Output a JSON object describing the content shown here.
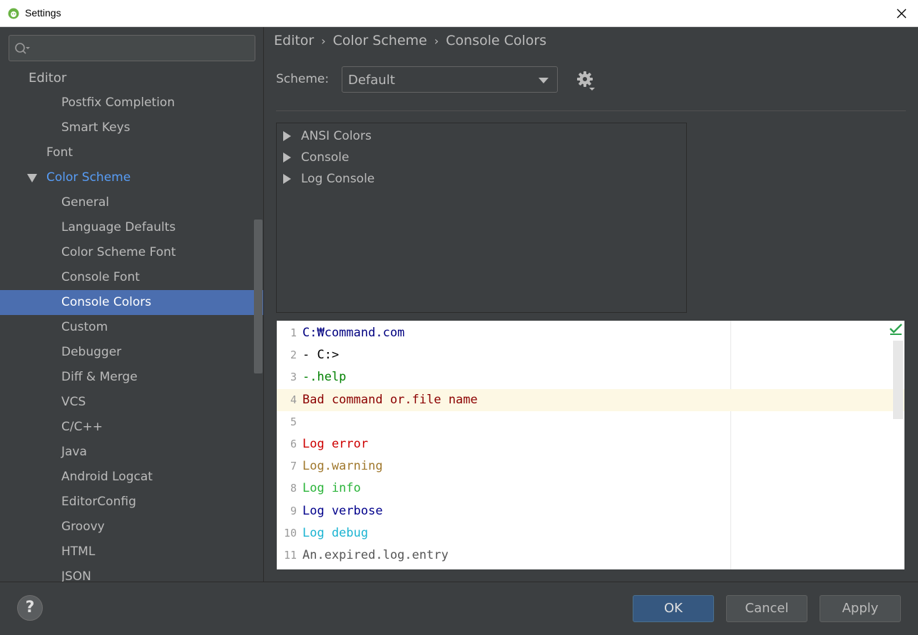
{
  "window": {
    "title": "Settings"
  },
  "search": {
    "placeholder": "",
    "value": ""
  },
  "sidebar": {
    "items": [
      {
        "label": "Editor",
        "level": 0
      },
      {
        "label": "Postfix Completion",
        "level": 2
      },
      {
        "label": "Smart Keys",
        "level": 2
      },
      {
        "label": "Font",
        "level": 1
      },
      {
        "label": "Color Scheme",
        "level": 1,
        "expanded": true
      },
      {
        "label": "General",
        "level": 2
      },
      {
        "label": "Language Defaults",
        "level": 2
      },
      {
        "label": "Color Scheme Font",
        "level": 2
      },
      {
        "label": "Console Font",
        "level": 2
      },
      {
        "label": "Console Colors",
        "level": 2,
        "selected": true
      },
      {
        "label": "Custom",
        "level": 2
      },
      {
        "label": "Debugger",
        "level": 2
      },
      {
        "label": "Diff & Merge",
        "level": 2
      },
      {
        "label": "VCS",
        "level": 2
      },
      {
        "label": "C/C++",
        "level": 2
      },
      {
        "label": "Java",
        "level": 2
      },
      {
        "label": "Android Logcat",
        "level": 2
      },
      {
        "label": "EditorConfig",
        "level": 2
      },
      {
        "label": "Groovy",
        "level": 2
      },
      {
        "label": "HTML",
        "level": 2
      },
      {
        "label": "JSON",
        "level": 2
      }
    ]
  },
  "breadcrumb": {
    "items": [
      "Editor",
      "Color Scheme",
      "Console Colors"
    ],
    "separator": "›"
  },
  "scheme": {
    "label": "Scheme:",
    "value": "Default"
  },
  "attributes": {
    "items": [
      "ANSI Colors",
      "Console",
      "Log Console"
    ]
  },
  "preview": {
    "lines": [
      {
        "num": "1",
        "text": "C:\\command.com",
        "display": "C:₩command.com",
        "color": "#000080"
      },
      {
        "num": "2",
        "text": "- C:>",
        "display": "- C:>",
        "color": "#000000"
      },
      {
        "num": "3",
        "text": "- help",
        "display": "-.help",
        "color": "#008000"
      },
      {
        "num": "4",
        "text": "Bad command or file name",
        "display": "Bad command or.file name",
        "color": "#8b0000",
        "current": true
      },
      {
        "num": "5",
        "text": "",
        "display": "",
        "color": "#000000"
      },
      {
        "num": "6",
        "text": "Log error",
        "display": "Log error",
        "color": "#cd0000"
      },
      {
        "num": "7",
        "text": "Log warning",
        "display": "Log.warning",
        "color": "#a0782d"
      },
      {
        "num": "8",
        "text": "Log info",
        "display": "Log info",
        "color": "#2bb43a"
      },
      {
        "num": "9",
        "text": "Log verbose",
        "display": "Log verbose",
        "color": "#00008b"
      },
      {
        "num": "10",
        "text": "Log debug",
        "display": "Log debug",
        "color": "#1cb4d2"
      },
      {
        "num": "11",
        "text": "An expired log entry",
        "display": "An.expired.log.entry",
        "color": "#555555"
      }
    ]
  },
  "buttons": {
    "ok": "OK",
    "cancel": "Cancel",
    "apply": "Apply",
    "help": "?"
  },
  "colors": {
    "selection": "#4b6eaf",
    "link": "#589df6",
    "ok_button": "#365880",
    "background": "#3c3f41"
  }
}
